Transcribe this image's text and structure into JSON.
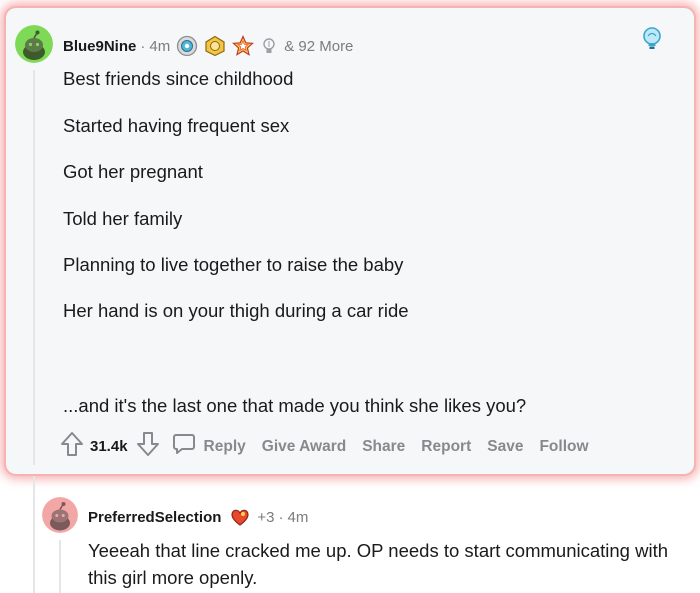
{
  "comment": {
    "username": "Blue9Nine",
    "time": "4m",
    "more_awards": "& 92 More",
    "lines": [
      "Best friends since childhood",
      "Started having frequent sex",
      "Got her pregnant",
      "Told her family",
      "Planning to live together to raise the baby",
      "Her hand is on your thigh during a car ride",
      "...and it's the last one that made you think she likes you?"
    ],
    "score": "31.4k",
    "actions": {
      "reply": "Reply",
      "give_award": "Give Award",
      "share": "Share",
      "report": "Report",
      "save": "Save",
      "follow": "Follow"
    },
    "avatar_color": "#7ed957",
    "card_glow": "#f07070"
  },
  "reply_comment": {
    "username": "PreferredSelection",
    "award_count": "+3",
    "time": "4m",
    "lines": [
      "Yeeeah that line cracked me up. OP needs to start communicating with",
      "this girl more openly."
    ],
    "avatar_color": "#f3a6a6"
  },
  "icons": [
    "award-silver-icon",
    "award-gold-icon",
    "award-star-icon",
    "award-bulb-icon",
    "upvote-icon",
    "downvote-icon",
    "comment-bubble-icon",
    "lightbulb-icon",
    "award-heart-icon"
  ]
}
